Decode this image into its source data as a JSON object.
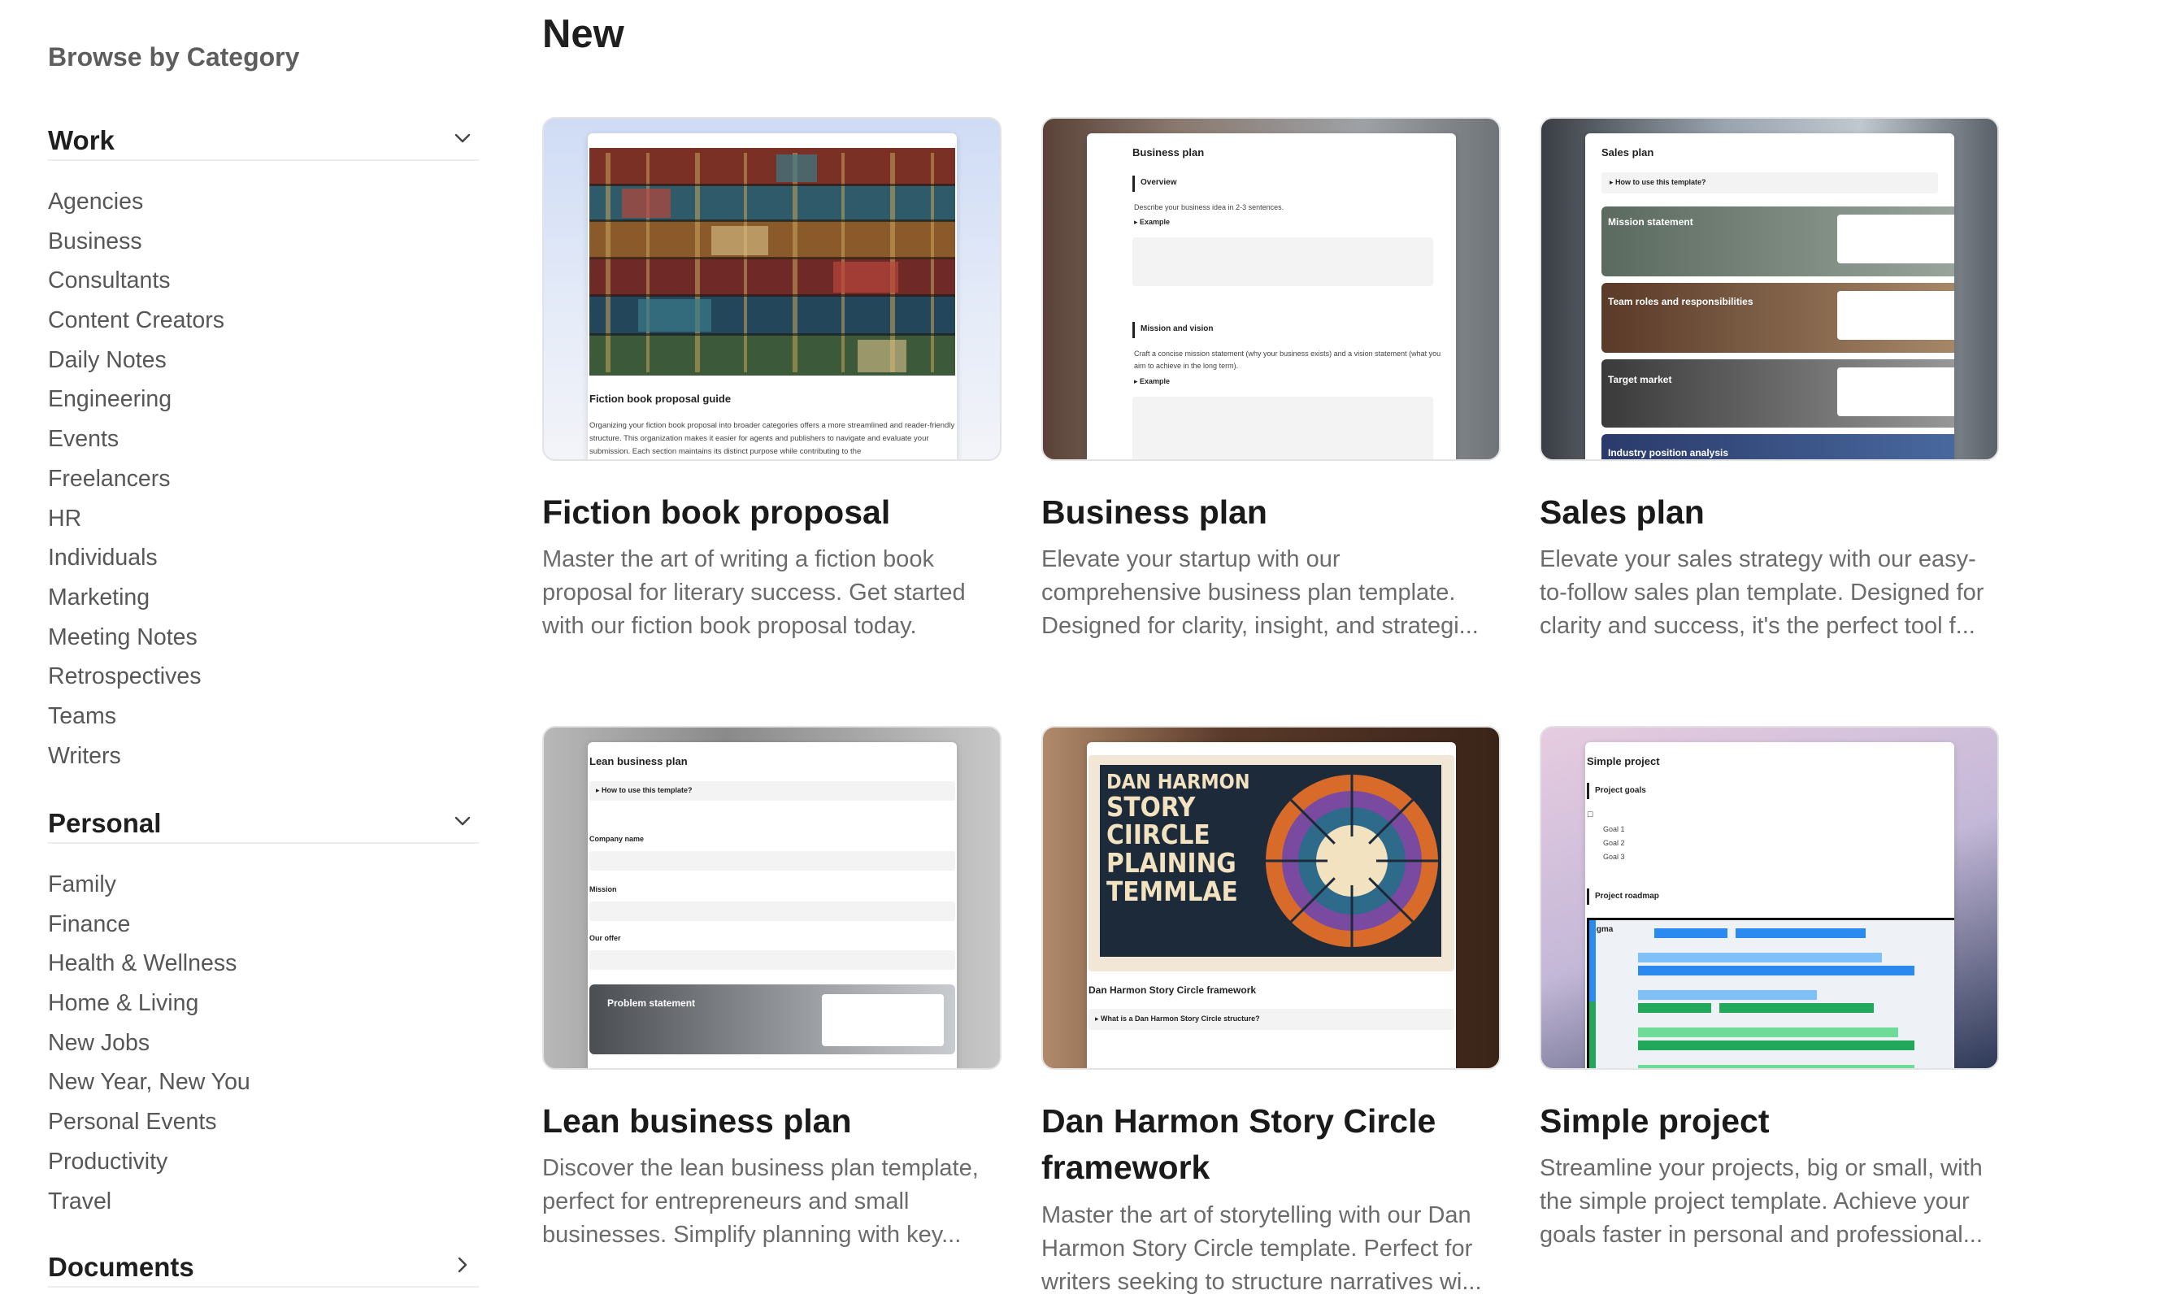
{
  "sidebar": {
    "title": "Browse by Category",
    "sections": [
      {
        "label": "Work",
        "expanded": true,
        "items": [
          "Agencies",
          "Business",
          "Consultants",
          "Content Creators",
          "Daily Notes",
          "Engineering",
          "Events",
          "Freelancers",
          "HR",
          "Individuals",
          "Marketing",
          "Meeting Notes",
          "Retrospectives",
          "Teams",
          "Writers"
        ]
      },
      {
        "label": "Personal",
        "expanded": true,
        "items": [
          "Family",
          "Finance",
          "Health & Wellness",
          "Home & Living",
          "New Jobs",
          "New Year, New You",
          "Personal Events",
          "Productivity",
          "Travel"
        ]
      },
      {
        "label": "Documents",
        "expanded": false,
        "items": []
      }
    ]
  },
  "main": {
    "title": "New",
    "cards": [
      {
        "title": "Fiction book proposal",
        "description": "Master the art of writing a fiction book proposal for literary success. Get started with our fiction book proposal today.",
        "thumb_heading": "Fiction book proposal guide",
        "thumb_body": "Organizing your fiction book proposal into broader categories offers a more streamlined and reader-friendly structure. This organization makes it easier for agents and publishers to navigate and evaluate your submission. Each section maintains its distinct purpose while contributing to the"
      },
      {
        "title": "Business plan",
        "description": "Elevate your startup with our comprehensive business plan template. Designed for clarity, insight, and strategi...",
        "thumb_heading": "Business plan",
        "thumb_s1": "Overview",
        "thumb_s1_text": "Describe your business idea in 2-3 sentences.",
        "thumb_toggle": "Example",
        "thumb_s2": "Mission and vision",
        "thumb_s2_text": "Craft a concise mission statement (why your business exists) and a vision statement (what you aim to achieve in the long term)."
      },
      {
        "title": "Sales plan",
        "description": "Elevate your sales strategy with our easy-to-follow sales plan template. Designed for clarity and success, it's the perfect tool f...",
        "thumb_heading": "Sales plan",
        "thumb_toggle": "How to use this template?",
        "thumb_blocks": [
          "Mission statement",
          "Team roles and responsibilities",
          "Target market",
          "Industry position analysis"
        ]
      },
      {
        "title": "Lean business plan",
        "description": "Discover the lean business plan template, perfect for entrepreneurs and small businesses. Simplify planning with key...",
        "thumb_heading": "Lean business plan",
        "thumb_toggle": "How to use this template?",
        "thumb_fields": [
          "Company name",
          "Mission",
          "Our offer"
        ],
        "thumb_block": "Problem statement"
      },
      {
        "title": "Dan Harmon Story Circle framework",
        "description": "Master the art of storytelling with our Dan Harmon Story Circle template. Perfect for writers seeking to structure narratives wi...",
        "thumb_poster_line1": "DAN HARMON",
        "thumb_poster_line2": "STORY",
        "thumb_poster_line3": "CIIRCLE",
        "thumb_poster_line4": "PLAINING",
        "thumb_poster_line5": "TEMMLAE",
        "thumb_heading": "Dan Harmon Story Circle framework",
        "thumb_toggle": "What is a Dan Harmon Story Circle structure?"
      },
      {
        "title": "Simple project",
        "description": "Streamline your projects, big or small, with the simple project template. Achieve your goals faster in personal and professional...",
        "thumb_heading": "Simple project",
        "thumb_s1": "Project goals",
        "thumb_goals": [
          "Goal 1",
          "Goal 2",
          "Goal 3"
        ],
        "thumb_s2": "Project roadmap",
        "thumb_chart_label": "igma"
      }
    ]
  },
  "colors": {
    "sidebar_text": "#575757",
    "heading": "#1f1f1f",
    "description": "#6b6b6b",
    "divider": "#ececec"
  }
}
